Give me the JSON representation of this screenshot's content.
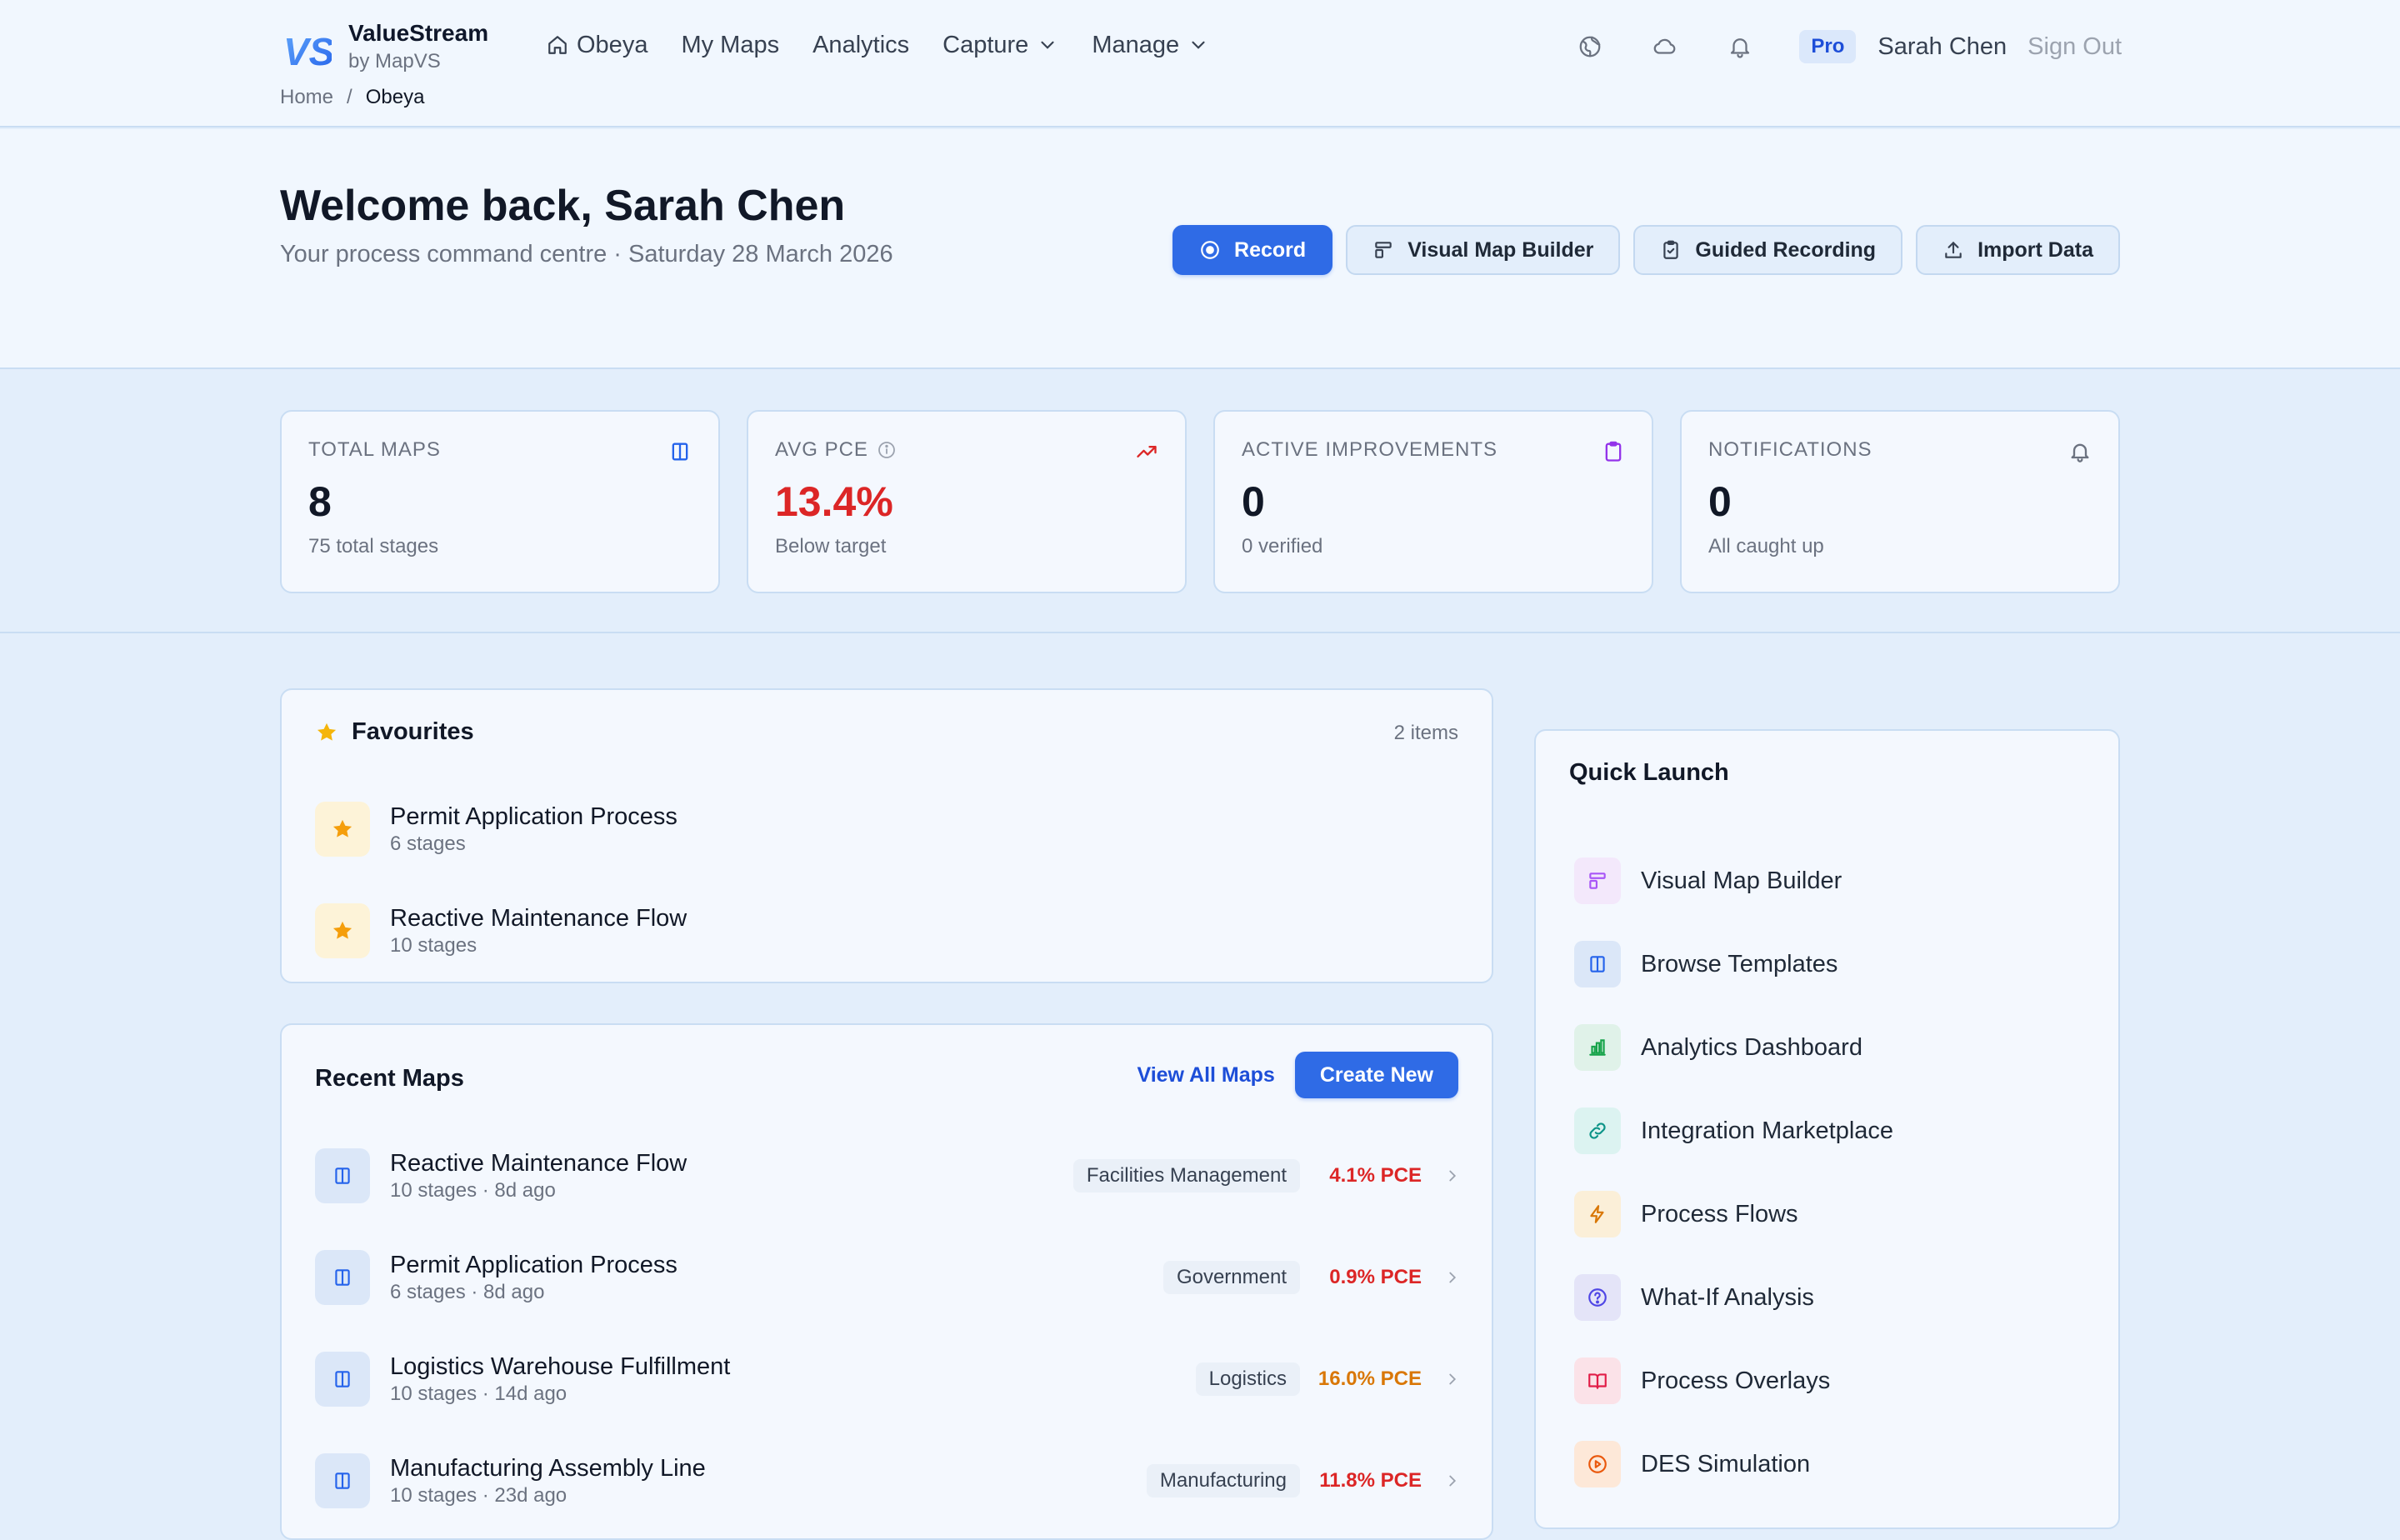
{
  "brand": {
    "name": "ValueStream",
    "sub": "by MapVS",
    "logo_text": "VS"
  },
  "nav": {
    "items": [
      {
        "label": "Obeya",
        "icon": "home-icon"
      },
      {
        "label": "My Maps"
      },
      {
        "label": "Analytics"
      },
      {
        "label": "Capture",
        "icon": "chevron-down-icon"
      },
      {
        "label": "Manage",
        "icon": "chevron-down-icon"
      }
    ]
  },
  "header": {
    "icons": [
      "globe-icon",
      "cloud-icon",
      "bell-icon"
    ],
    "plan_badge": "Pro",
    "user_name": "Sarah Chen",
    "sign_out": "Sign Out"
  },
  "breadcrumb": {
    "home": "Home",
    "separator": "/",
    "current": "Obeya"
  },
  "hero": {
    "title": "Welcome back, Sarah Chen",
    "subtitle": "Your process command centre · Saturday 28 March 2026",
    "actions": {
      "record": "Record",
      "visual_map_builder": "Visual Map Builder",
      "guided_recording": "Guided Recording",
      "import_data": "Import Data"
    }
  },
  "stats": [
    {
      "label": "TOTAL MAPS",
      "value": "8",
      "sub": "75 total stages",
      "icon": "map-icon",
      "color": "#2563eb"
    },
    {
      "label": "AVG PCE",
      "value": "13.4%",
      "sub": "Below target",
      "icon": "trending-up-icon",
      "color": "#dc2626"
    },
    {
      "label": "ACTIVE IMPROVEMENTS",
      "value": "0",
      "sub": "0 verified",
      "icon": "clipboard-icon",
      "color": "#9333ea"
    },
    {
      "label": "NOTIFICATIONS",
      "value": "0",
      "sub": "All caught up",
      "icon": "bell-icon",
      "color": "#6b7280"
    }
  ],
  "favourites": {
    "title": "Favourites",
    "count": "2 items",
    "items": [
      {
        "title": "Permit Application Process",
        "sub": "6 stages"
      },
      {
        "title": "Reactive Maintenance Flow",
        "sub": "10 stages"
      }
    ]
  },
  "recent": {
    "title": "Recent Maps",
    "view_all": "View All Maps",
    "create_new": "Create New",
    "rows": [
      {
        "title": "Reactive Maintenance Flow",
        "sub": "10 stages · 8d ago",
        "tag": "Facilities Management",
        "pce": "4.1% PCE",
        "pce_color": "#dc2626"
      },
      {
        "title": "Permit Application Process",
        "sub": "6 stages · 8d ago",
        "tag": "Government",
        "pce": "0.9% PCE",
        "pce_color": "#dc2626"
      },
      {
        "title": "Logistics Warehouse Fulfillment",
        "sub": "10 stages · 14d ago",
        "tag": "Logistics",
        "pce": "16.0% PCE",
        "pce_color": "#d97706"
      },
      {
        "title": "Manufacturing Assembly Line",
        "sub": "10 stages · 23d ago",
        "tag": "Manufacturing",
        "pce": "11.8% PCE",
        "pce_color": "#dc2626"
      }
    ]
  },
  "quick_launch": {
    "title": "Quick Launch",
    "items": [
      {
        "label": "Visual Map Builder",
        "icon": "layout-icon",
        "color": "#a855f7",
        "bg": "#f3e8fb"
      },
      {
        "label": "Browse Templates",
        "icon": "columns-icon",
        "color": "#2563eb",
        "bg": "#dbe7f8"
      },
      {
        "label": "Analytics Dashboard",
        "icon": "bar-chart-icon",
        "color": "#16a34a",
        "bg": "#e0f2e9"
      },
      {
        "label": "Integration Marketplace",
        "icon": "link-icon",
        "color": "#0d9488",
        "bg": "#dcf3f1"
      },
      {
        "label": "Process Flows",
        "icon": "zap-icon",
        "color": "#d97706",
        "bg": "#fbefd8"
      },
      {
        "label": "What-If Analysis",
        "icon": "help-circle-icon",
        "color": "#4f46e5",
        "bg": "#e4e4f8"
      },
      {
        "label": "Process Overlays",
        "icon": "book-open-icon",
        "color": "#e11d48",
        "bg": "#fbe2e8"
      },
      {
        "label": "DES Simulation",
        "icon": "play-circle-icon",
        "color": "#ea580c",
        "bg": "#fde8d8"
      }
    ]
  }
}
